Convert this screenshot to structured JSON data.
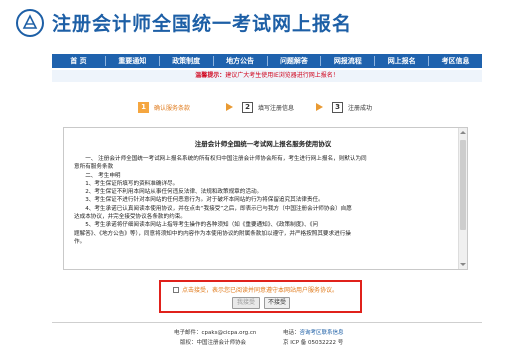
{
  "header": {
    "site_title": "注册会计师全国统一考试网上报名"
  },
  "nav": {
    "items": [
      {
        "label": "首 页"
      },
      {
        "label": "重要通知"
      },
      {
        "label": "政策制度"
      },
      {
        "label": "地方公告"
      },
      {
        "label": "问题解答"
      },
      {
        "label": "网报流程"
      },
      {
        "label": "网上报名"
      },
      {
        "label": "考区信息"
      }
    ]
  },
  "tip": {
    "key": "温馨提示：",
    "text": "建议广大考生使用IE浏览器进行网上报名！"
  },
  "steps": [
    {
      "num": "1",
      "label": "确认服务条款",
      "active": true
    },
    {
      "num": "2",
      "label": "填写注册信息",
      "active": false
    },
    {
      "num": "3",
      "label": "注册成功",
      "active": false
    }
  ],
  "agreement": {
    "title": "注册会计师全国统一考试网上报名服务使用协议",
    "lines": [
      "　　一、 注册会计师全国统一考试网上报名系统的所有权归中国注册会计师协会所有，考生进行网上报名，则默认为同",
      "意所有服务条款",
      "　　二、 考生申明",
      "　　1、考生保证所填写的资料准确详尽。",
      "　　2、考生保证不利用本网站从事任何违反法律、法规和政策规章的活动。",
      "　　3、考生保证不进行针对本网站的任何恶意行为。对于破坏本网站的行为将保留追究其法律责任。",
      "　　4、考生承诺已认真阅读本使用协议，并在点击“我接受”之后，即表示已与我方（中国注册会计师协会）自愿",
      "达成本协议，并完全接受协议各条款的约束。",
      "　　5、考生承诺将仔细阅读本网站上指导考生操作的各种须知（如《重要通知》、《政策制度》、《问",
      "题解答》、《地方公告》等），同意将须知中的内容作为本使用协议的附属条款加以遵守，并严格按照其要求进行操",
      "作。"
    ]
  },
  "accept": {
    "checkbox_label": "点击接受，表示您已阅读并同意遵守本网站用户服务协议。",
    "accept_button": "我接受",
    "decline_button": "不接受"
  },
  "footer": {
    "email_label": "电子邮件：",
    "email": "cpaks@cicpa.org.cn",
    "phone_label": "电话：",
    "phone_link": "咨询考区联系信息",
    "copyright_label": "版权：",
    "copyright": "中国注册会计师协会",
    "icp": "京 ICP 备 05032222 号"
  }
}
